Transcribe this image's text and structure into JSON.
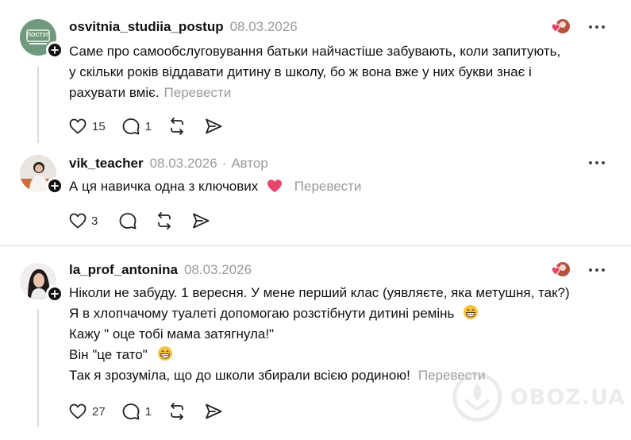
{
  "colors": {
    "accent_heart": "#e8456b",
    "muted": "#9a9a9a",
    "text": "#111111"
  },
  "posts": [
    {
      "username": "osvitnia_studiia_postup",
      "date": "08.03.2026",
      "avatar_text": "ПОСТУП",
      "lines": [
        "Саме про самообслуговування батьки найчастіше забувають, коли запитують,",
        "у скільки років віддавати дитину в школу, бо ж вона вже у них букви знає і",
        "рахувати вміє."
      ],
      "translate": "Перевести",
      "likes": "15",
      "replies": "1"
    },
    {
      "username": "vik_teacher",
      "date": "08.03.2026",
      "separator": "·",
      "author_label": "Автор",
      "text": "А ця навичка одна з ключових",
      "translate": "Перевести",
      "likes": "3"
    },
    {
      "username": "la_prof_antonina",
      "date": "08.03.2026",
      "lines": [
        "Ніколи не забуду. 1 вересня. У мене перший клас (уявляєте, яка метушня, так?)",
        "Я в хлопчачому туалеті допомогаю розстібнути дитині ремінь",
        "Кажу \" оце тобі мама затягнула!\"",
        "Він \"це тато\"",
        "Так я зрозуміла, що до школи збирали всією родиною!"
      ],
      "translate": "Перевести",
      "likes": "27",
      "replies": "1"
    }
  ],
  "watermark": "OBOZ.UA"
}
